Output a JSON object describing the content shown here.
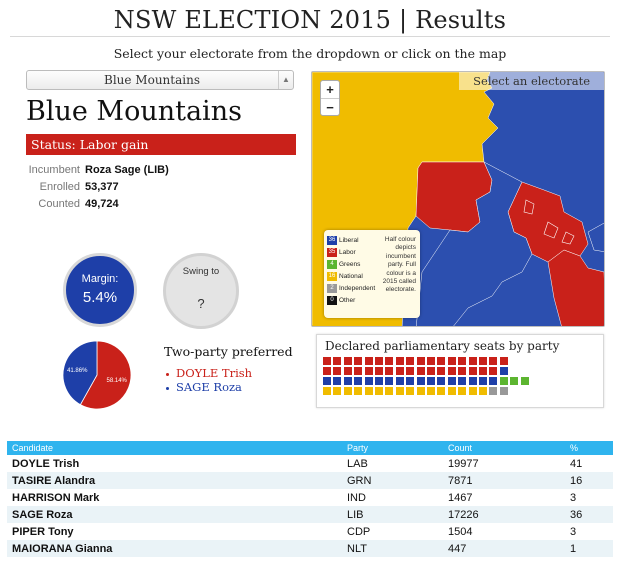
{
  "header": {
    "title": "NSW ELECTION 2015 | Results",
    "subtitle": "Select your electorate from the dropdown or click on the map"
  },
  "dropdown": {
    "selected": "Blue Mountains"
  },
  "electorate": {
    "name": "Blue Mountains",
    "status": "Status: Labor gain",
    "incumbent_label": "Incumbent",
    "incumbent": "Roza Sage (LIB)",
    "enrolled_label": "Enrolled",
    "enrolled": "53,377",
    "counted_label": "Counted",
    "counted": "49,724"
  },
  "margin": {
    "label": "Margin:",
    "value": "5.4%"
  },
  "swing": {
    "label": "Swing to",
    "value": "?"
  },
  "two_party": {
    "title": "Two-party preferred",
    "candidates": [
      {
        "name": "DOYLE Trish",
        "color": "#c9211a"
      },
      {
        "name": "SAGE Roza",
        "color": "#1e3fa8"
      }
    ]
  },
  "chart_data": {
    "type": "pie",
    "title": "",
    "slices": [
      {
        "label": "58.14%",
        "value": 58.14,
        "color": "#c9211a"
      },
      {
        "label": "41.86%",
        "value": 41.86,
        "color": "#1e3fa8"
      }
    ]
  },
  "map": {
    "prompt": "Select an electorate",
    "zoom_in": "+",
    "zoom_out": "−",
    "legend": [
      {
        "count": "36",
        "label": "Liberal",
        "color": "#1e3fa8"
      },
      {
        "count": "35",
        "label": "Labor",
        "color": "#c9211a"
      },
      {
        "count": "4",
        "label": "Greens",
        "color": "#5cb530"
      },
      {
        "count": "16",
        "label": "National",
        "color": "#f0bc00"
      },
      {
        "count": "2",
        "label": "Independent",
        "color": "#999999"
      },
      {
        "count": "0",
        "label": "Other",
        "color": "#111111"
      }
    ],
    "legend_note": "Half colour depicts incumbent party. Full colour is a 2015 called electorate."
  },
  "seats": {
    "title": "Declared parliamentary seats by party",
    "rows": [
      {
        "count": 18,
        "color": "#c9211a"
      },
      {
        "count": 17,
        "color": "#c9211a",
        "rest": 1,
        "rest_color": "#1e3fa8"
      },
      {
        "count": 17,
        "color": "#1e3fa8",
        "rest": 0,
        "rest_color": "#5cb530",
        "extra": 3
      },
      {
        "count": 16,
        "color": "#f0bc00",
        "rest": 2,
        "rest_color": "#999999"
      }
    ]
  },
  "results": {
    "headers": [
      "Candidate",
      "Party",
      "Count",
      "%"
    ],
    "rows": [
      {
        "candidate": "DOYLE Trish",
        "party": "LAB",
        "count": "19977",
        "pct": "41"
      },
      {
        "candidate": "TASIRE Alandra",
        "party": "GRN",
        "count": "7871",
        "pct": "16"
      },
      {
        "candidate": "HARRISON Mark",
        "party": "IND",
        "count": "1467",
        "pct": "3"
      },
      {
        "candidate": "SAGE Roza",
        "party": "LIB",
        "count": "17226",
        "pct": "36"
      },
      {
        "candidate": "PIPER Tony",
        "party": "CDP",
        "count": "1504",
        "pct": "3"
      },
      {
        "candidate": "MAIORANA Gianna",
        "party": "NLT",
        "count": "447",
        "pct": "1"
      }
    ]
  }
}
